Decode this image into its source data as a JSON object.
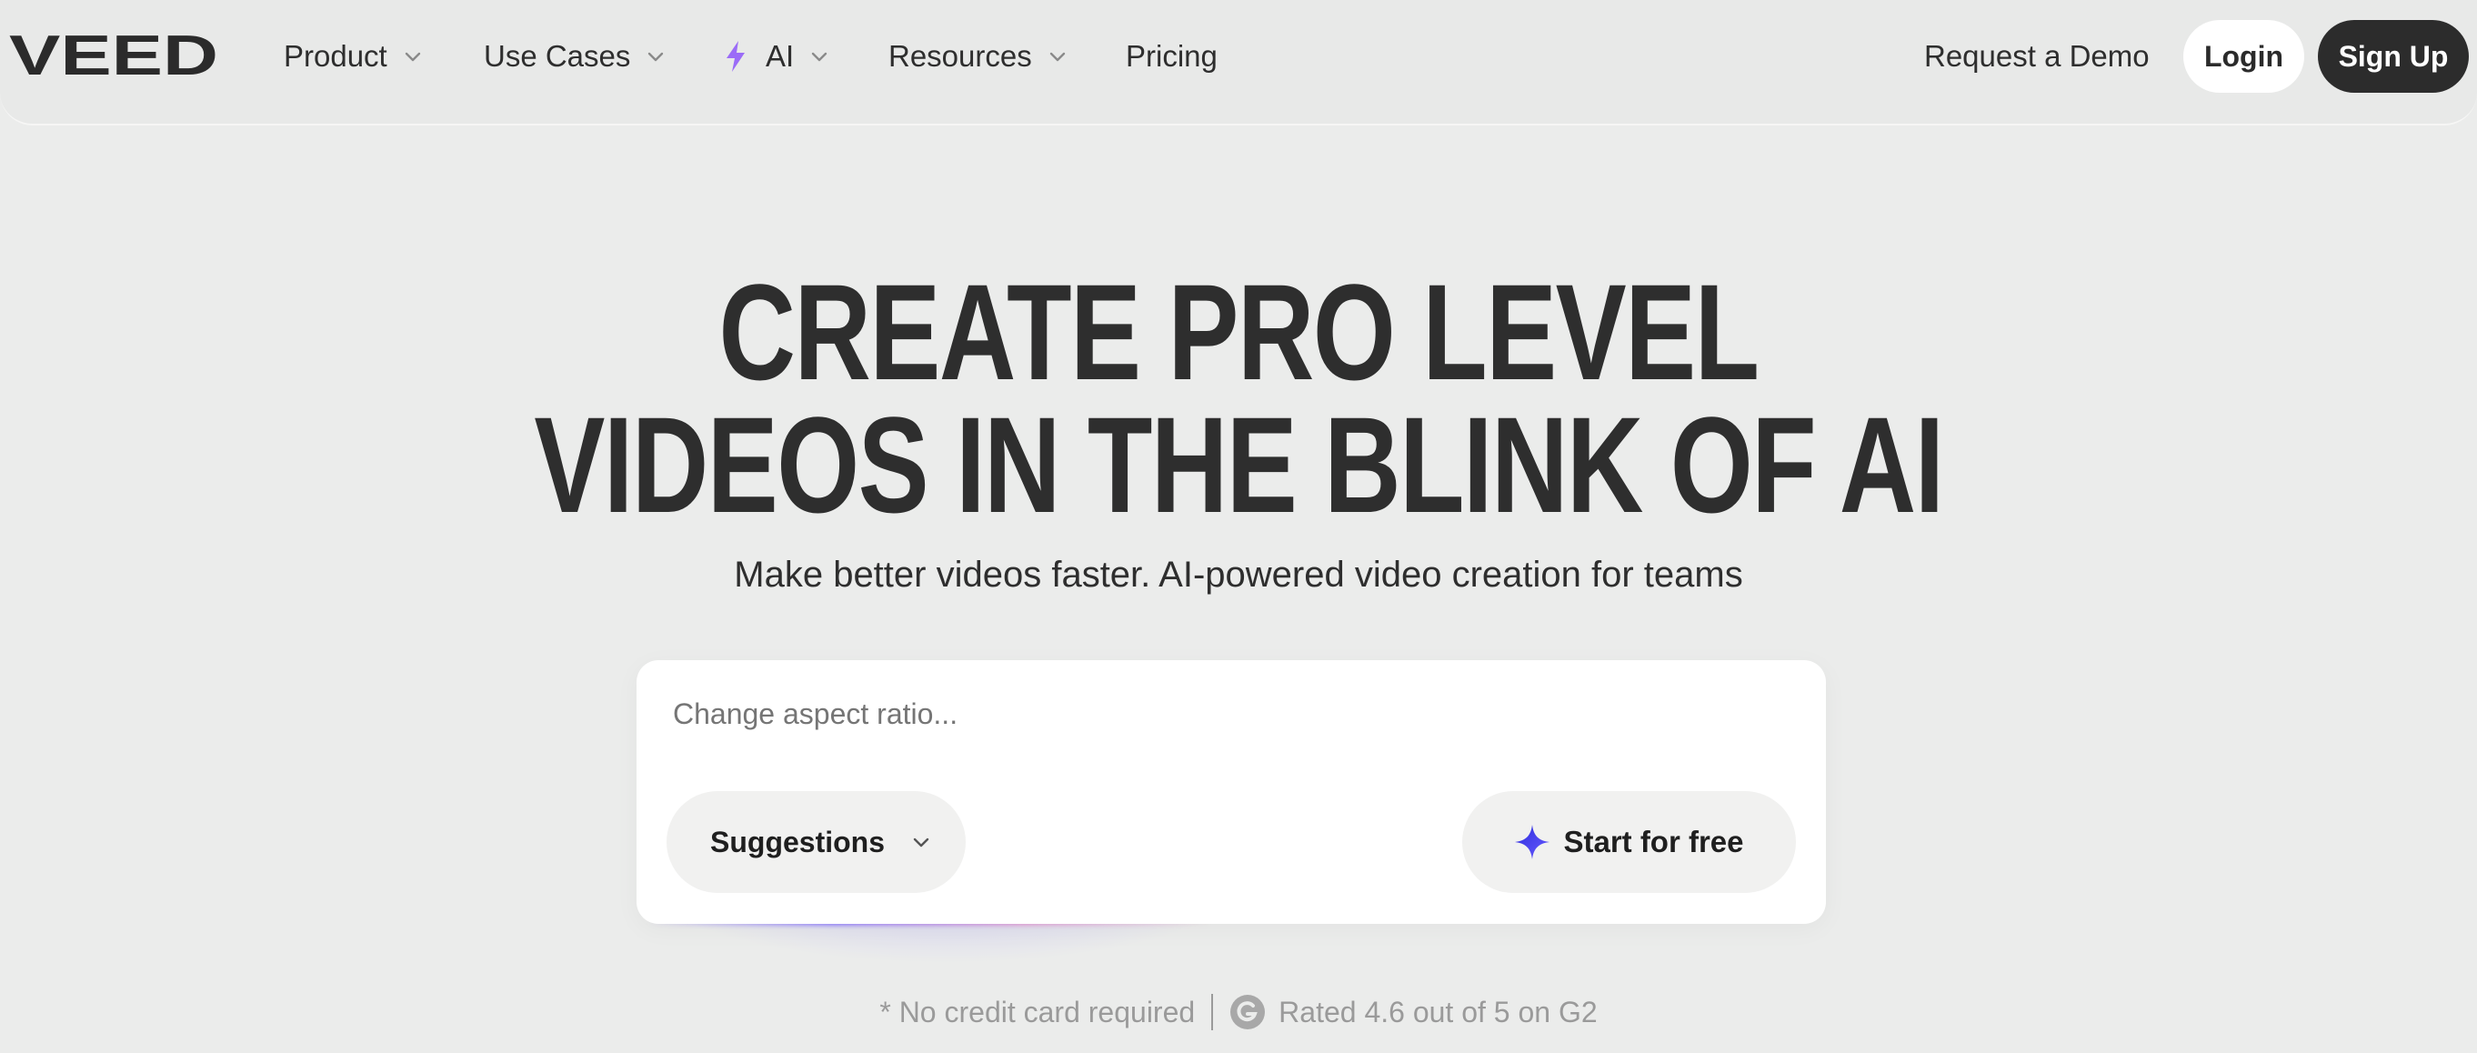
{
  "brand": {
    "logo_text": "VEED"
  },
  "nav": {
    "items": [
      {
        "label": "Product",
        "has_dropdown": true
      },
      {
        "label": "Use Cases",
        "has_dropdown": true
      },
      {
        "label": "AI",
        "has_dropdown": true,
        "icon": "bolt-icon"
      },
      {
        "label": "Resources",
        "has_dropdown": true
      },
      {
        "label": "Pricing",
        "has_dropdown": false
      }
    ],
    "request_demo_label": "Request a Demo",
    "login_label": "Login",
    "signup_label": "Sign Up"
  },
  "hero": {
    "title_line1": "CREATE PRO LEVEL",
    "title_line2": "VIDEOS IN THE BLINK OF AI",
    "subtitle": "Make better videos faster. AI-powered video creation for teams"
  },
  "prompt": {
    "placeholder": "Change aspect ratio...",
    "value": "",
    "suggestions_label": "Suggestions",
    "start_label": "Start for free"
  },
  "footnote": {
    "no_card": "* No credit card required",
    "rating": "Rated 4.6 out of 5 on G2"
  },
  "colors": {
    "background": "#ebeceb",
    "text": "#2e2e2e",
    "signup_bg": "#2c2c2c",
    "ai_bolt": "#9b6cf7",
    "sparkle": "#3b3bf0",
    "muted": "#9a9a9a"
  }
}
